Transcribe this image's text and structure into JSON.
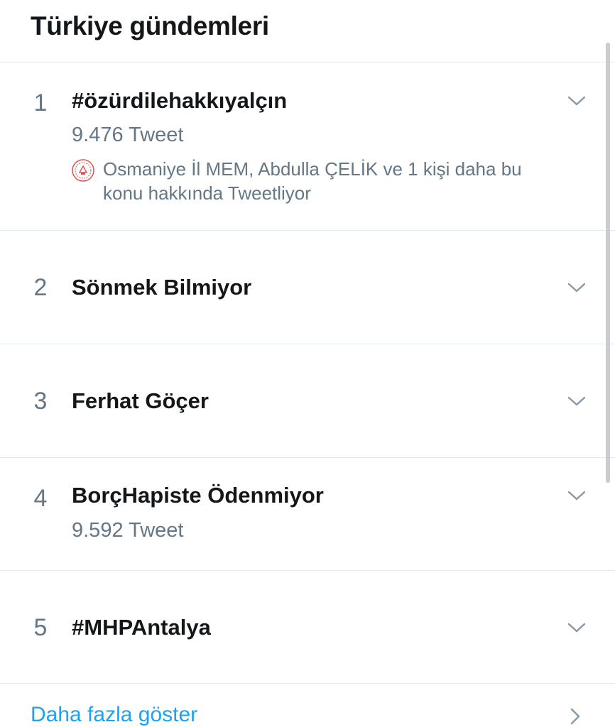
{
  "header": {
    "title": "Türkiye gündemleri"
  },
  "trends": [
    {
      "rank": "1",
      "name": "#özürdilehakkıyalçın",
      "tweet_count": "9.476 Tweet",
      "context_line1": "Osmaniye İl MEM, Abdulla ÇELİK ve 1 kişi daha bu",
      "context_line2": "konu hakkında Tweetliyor",
      "context_avatar_icon": "ministry-seal-icon"
    },
    {
      "rank": "2",
      "name": "Sönmek Bilmiyor"
    },
    {
      "rank": "3",
      "name": "Ferhat Göçer"
    },
    {
      "rank": "4",
      "name": "BorçHapiste Ödenmiyor",
      "tweet_count": "9.592 Tweet"
    },
    {
      "rank": "5",
      "name": "#MHPAntalya"
    }
  ],
  "footer": {
    "show_more_label": "Daha fazla göster",
    "chevron_icon": "chevron-right-icon"
  },
  "colors": {
    "primary_text": "#14171a",
    "secondary_text": "#657786",
    "link": "#1da1f2",
    "divider": "#e1e8ed",
    "chevron": "#8899a6"
  }
}
